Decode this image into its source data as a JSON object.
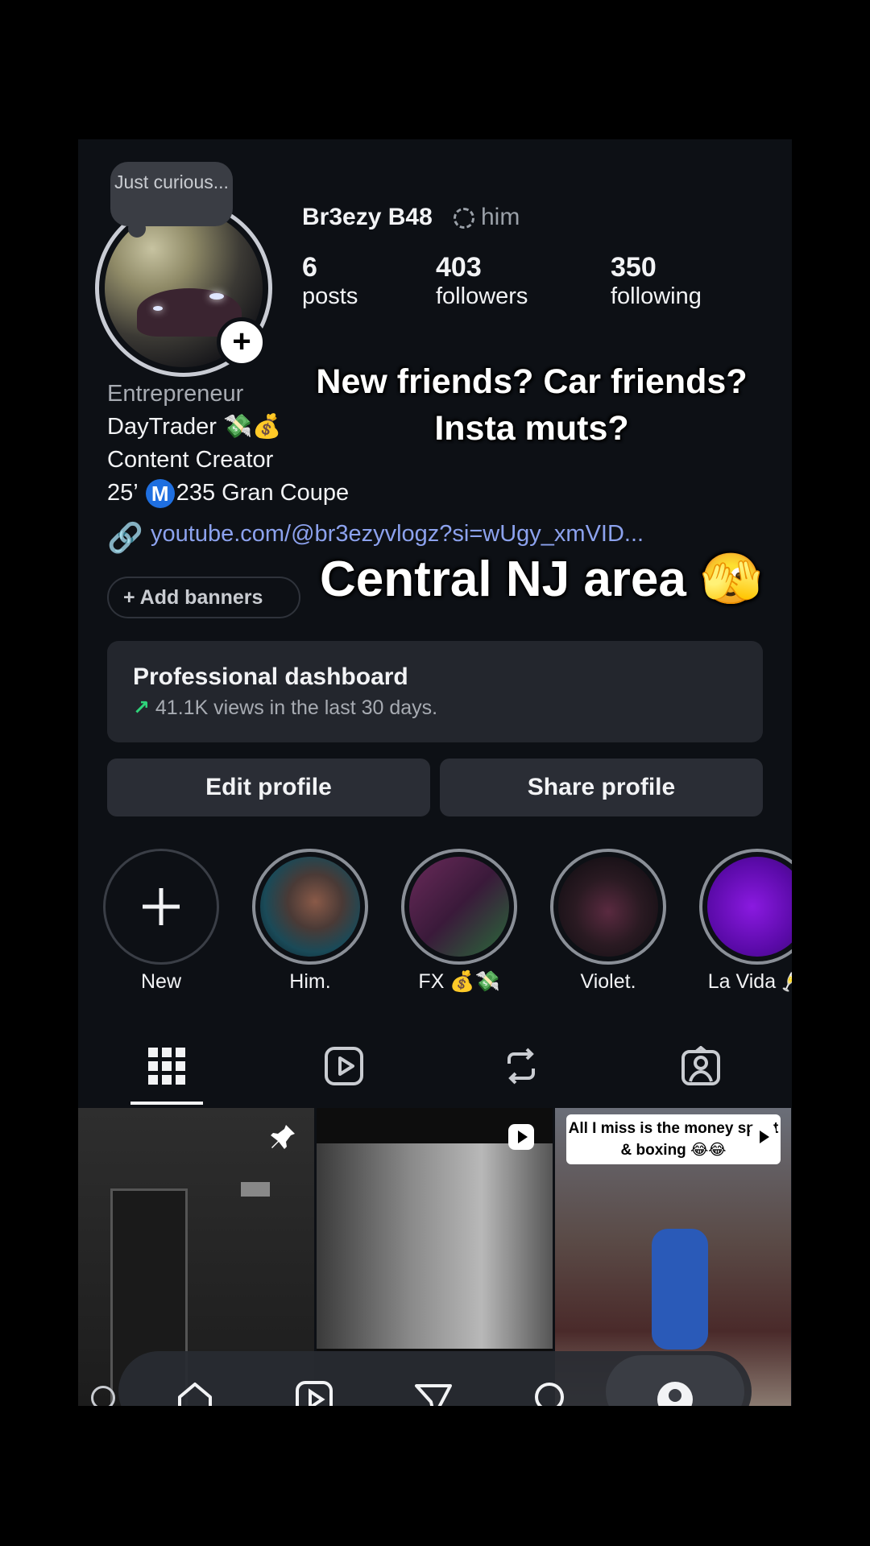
{
  "profile": {
    "username": "Br3ezy B48",
    "pronouns": "him",
    "note": "Just curious...",
    "stats": [
      {
        "value": "6",
        "label": "posts"
      },
      {
        "value": "403",
        "label": "followers"
      },
      {
        "value": "350",
        "label": "following"
      }
    ],
    "bio": {
      "category": "Entrepreneur",
      "line1": "DayTrader 💸💰",
      "line2": "Content Creator",
      "line3_pre": "25’",
      "line3_badge": "M",
      "line3_post": "235 Gran Coupe"
    },
    "link": "youtube.com/@br3ezyvlogz?si=wUgy_xmVID...",
    "add_banners": "Add banners"
  },
  "overlay_text": {
    "line1": "New friends? Car friends?",
    "line2": "Insta muts?",
    "area": "Central NJ area 🫣"
  },
  "dashboard": {
    "title": "Professional dashboard",
    "subtitle": "41.1K views in the last 30 days."
  },
  "buttons": {
    "edit": "Edit profile",
    "share": "Share profile"
  },
  "highlights": [
    {
      "label": "New"
    },
    {
      "label": "Him."
    },
    {
      "label": "FX 💰💸"
    },
    {
      "label": "Violet."
    },
    {
      "label": "La Vida 🥂"
    }
  ],
  "posts": [
    {
      "overlay_caption": ""
    },
    {
      "overlay_caption": ""
    },
    {
      "overlay_caption": "All I miss is the money spent & boxing 😂😂"
    }
  ],
  "colors": {
    "background": "#0d1015",
    "link": "#8ca2ee",
    "card": "#23262d",
    "button": "#2a2d35",
    "trend_up": "#2fd37a"
  },
  "icons": {
    "tabs": [
      "grid-icon",
      "reels-icon",
      "reposts-icon",
      "tagged-icon"
    ],
    "nav": [
      "home-icon",
      "reels-icon",
      "send-icon",
      "search-icon",
      "profile-icon"
    ]
  }
}
